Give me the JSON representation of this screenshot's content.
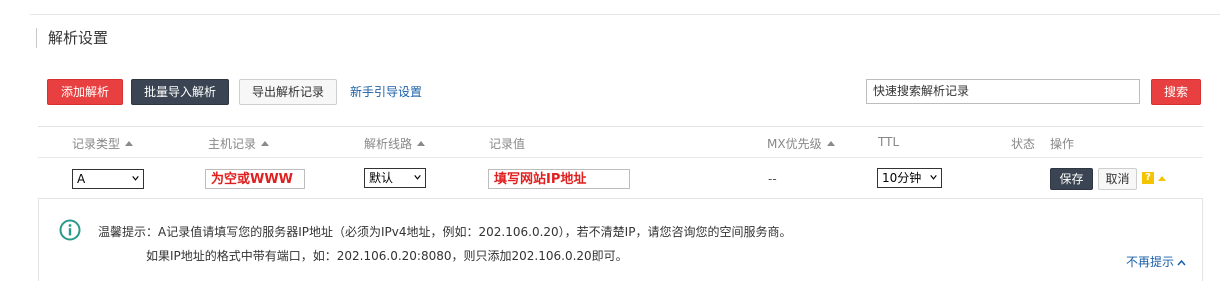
{
  "page": {
    "title": "解析设置"
  },
  "toolbar": {
    "add": "添加解析",
    "batch_import": "批量导入解析",
    "export": "导出解析记录",
    "guide": "新手引导设置",
    "search_placeholder": "快速搜索解析记录",
    "search": "搜索"
  },
  "table": {
    "headers": {
      "record_type": "记录类型",
      "host": "主机记录",
      "line": "解析线路",
      "value": "记录值",
      "mx": "MX优先级",
      "ttl": "TTL",
      "status": "状态",
      "actions": "操作"
    },
    "edit_row": {
      "record_type": "A",
      "host_hint": "为空或WWW",
      "line": "默认",
      "value_hint": "填写网站IP地址",
      "mx": "--",
      "ttl": "10分钟",
      "save": "保存",
      "cancel": "取消",
      "help": "?"
    }
  },
  "tip": {
    "label": "温馨提示：",
    "line1": "A记录值请填写您的服务器IP地址（必须为IPv4地址，例如：202.106.0.20），若不清楚IP，请您咨询您的空间服务商。",
    "line2": "如果IP地址的格式中带有端口，如：202.106.0.20:8080，则只添加202.106.0.20即可。",
    "dismiss": "不再提示"
  },
  "colors": {
    "accent_red": "#e84040",
    "dark_button": "#3b4452",
    "link": "#1a5fa8",
    "hint_red": "#e02020",
    "help_yellow": "#f5c400"
  }
}
